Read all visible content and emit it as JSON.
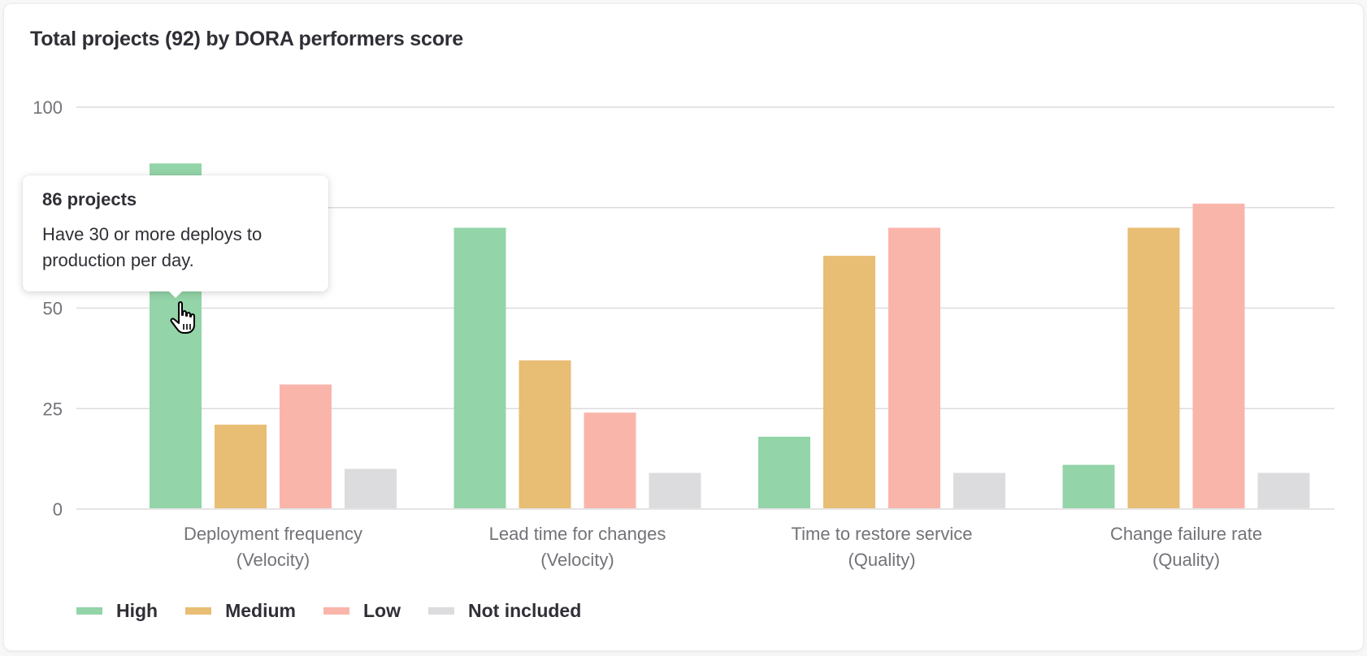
{
  "card": {
    "title": "Total projects (92) by DORA performers score"
  },
  "chart_data": {
    "type": "bar",
    "title": "Total projects (92) by DORA performers score",
    "xlabel": "",
    "ylabel": "",
    "ylim": [
      0,
      100
    ],
    "yticks": [
      0,
      25,
      50,
      75,
      100
    ],
    "ytick_labels": [
      "0",
      "25",
      "50",
      "75",
      "100"
    ],
    "grid": true,
    "legend_position": "bottom-left",
    "categories": [
      [
        "Deployment frequency",
        "(Velocity)"
      ],
      [
        "Lead time for changes",
        "(Velocity)"
      ],
      [
        "Time to restore service",
        "(Quality)"
      ],
      [
        "Change failure rate",
        "(Quality)"
      ]
    ],
    "series": [
      {
        "name": "High",
        "color": "#93d4a8",
        "values": [
          86,
          70,
          18,
          11
        ]
      },
      {
        "name": "Medium",
        "color": "#e8bd74",
        "values": [
          21,
          37,
          63,
          70
        ]
      },
      {
        "name": "Low",
        "color": "#fab5ab",
        "values": [
          31,
          24,
          70,
          76
        ]
      },
      {
        "name": "Not included",
        "color": "#dcdcde",
        "values": [
          10,
          9,
          9,
          9
        ]
      }
    ]
  },
  "legend": {
    "items": [
      {
        "label": "High",
        "color": "#93d4a8"
      },
      {
        "label": "Medium",
        "color": "#e8bd74"
      },
      {
        "label": "Low",
        "color": "#fab5ab"
      },
      {
        "label": "Not included",
        "color": "#dcdcde"
      }
    ]
  },
  "tooltip": {
    "title": "86 projects",
    "body": "Have 30 or more deploys to production per day."
  },
  "icons": {
    "cursor": "hand-pointer-icon"
  }
}
